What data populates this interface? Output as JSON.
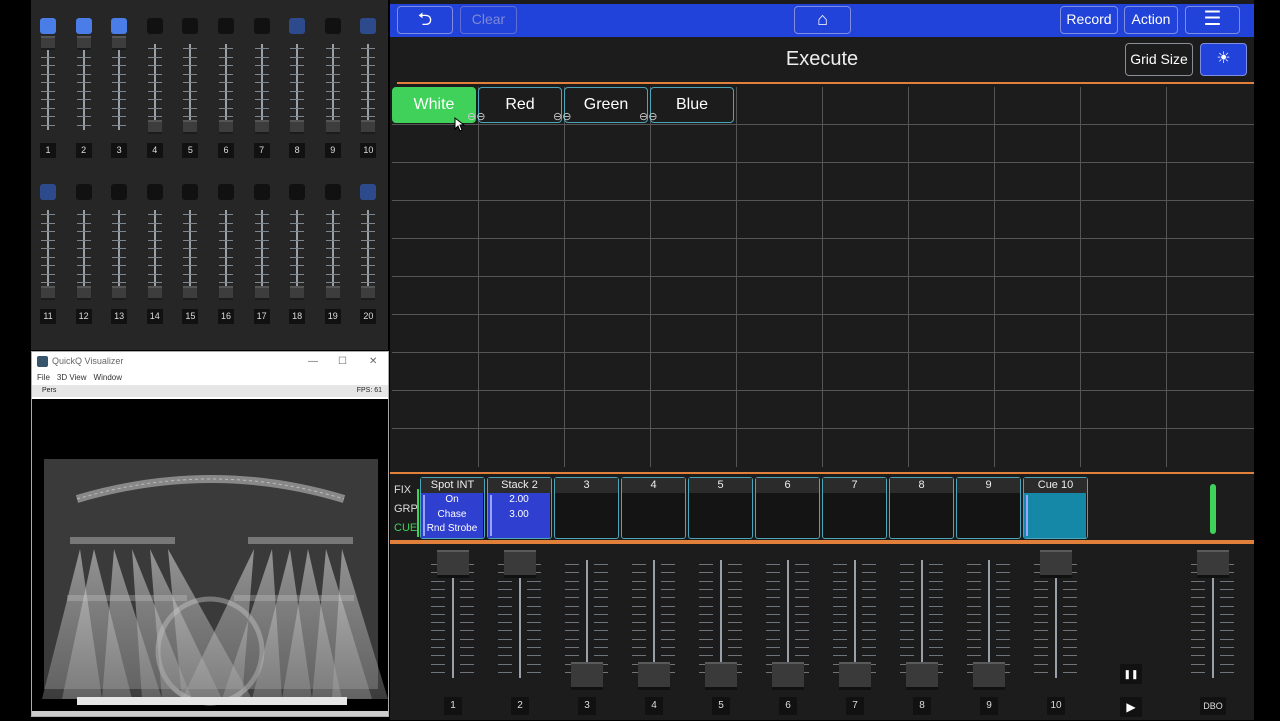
{
  "colors": {
    "accent_blue": "#2243d9",
    "active_green": "#3fd15a",
    "outline_teal": "#4aa6b8",
    "orange_rule": "#e0803b",
    "playback_blue": "#2f3fd0",
    "playback_teal": "#1588a8"
  },
  "mini_faders": {
    "row1": [
      {
        "num": "1",
        "button": "on"
      },
      {
        "num": "2",
        "button": "on"
      },
      {
        "num": "3",
        "button": "on"
      },
      {
        "num": "4",
        "button": "off"
      },
      {
        "num": "5",
        "button": "off"
      },
      {
        "num": "6",
        "button": "off"
      },
      {
        "num": "7",
        "button": "off"
      },
      {
        "num": "8",
        "button": "dim"
      },
      {
        "num": "9",
        "button": "off"
      },
      {
        "num": "10",
        "button": "dim"
      }
    ],
    "row2": [
      {
        "num": "11",
        "button": "dim"
      },
      {
        "num": "12",
        "button": "off"
      },
      {
        "num": "13",
        "button": "off"
      },
      {
        "num": "14",
        "button": "off"
      },
      {
        "num": "15",
        "button": "off"
      },
      {
        "num": "16",
        "button": "off"
      },
      {
        "num": "17",
        "button": "off"
      },
      {
        "num": "18",
        "button": "off"
      },
      {
        "num": "19",
        "button": "off"
      },
      {
        "num": "20",
        "button": "dim"
      }
    ]
  },
  "visualizer": {
    "title": "QuickQ Visualizer",
    "menu": [
      "File",
      "3D View",
      "Window"
    ],
    "view_mode": "Pers",
    "fps": "FPS: 61",
    "minimize": "—",
    "maximize": "☐",
    "close": "✕"
  },
  "topbar": {
    "back_icon": "undo-icon",
    "back_glyph": "⮌",
    "clear_label": "Clear",
    "home_icon": "home-icon",
    "home_glyph": "⌂",
    "record_label": "Record",
    "action_label": "Action",
    "menu_icon": "hamburger-icon",
    "menu_glyph": "☰"
  },
  "execute": {
    "title": "Execute",
    "grid_size_label": "Grid Size",
    "light_icon": "bulb-icon",
    "light_glyph": "☀",
    "cells": [
      {
        "label": "White",
        "active": true
      },
      {
        "label": "Red",
        "active": false
      },
      {
        "label": "Green",
        "active": false
      },
      {
        "label": "Blue",
        "active": false
      }
    ],
    "link_glyph": "⊖⊖"
  },
  "playbacks": {
    "modes": [
      "FIX",
      "GRP",
      "CUE"
    ],
    "items": [
      {
        "title": "Spot INT",
        "lines": [
          "On",
          "Chase",
          "Rnd Strobe"
        ],
        "style": "blue"
      },
      {
        "title": "Stack 2",
        "lines": [
          "2.00",
          "3.00"
        ],
        "style": "blue"
      },
      {
        "title": "3",
        "lines": [],
        "style": "empty"
      },
      {
        "title": "4",
        "lines": [],
        "style": "empty"
      },
      {
        "title": "5",
        "lines": [],
        "style": "empty"
      },
      {
        "title": "6",
        "lines": [],
        "style": "empty"
      },
      {
        "title": "7",
        "lines": [],
        "style": "empty"
      },
      {
        "title": "8",
        "lines": [],
        "style": "empty"
      },
      {
        "title": "9",
        "lines": [],
        "style": "empty"
      },
      {
        "title": "Cue 10",
        "lines": [],
        "style": "teal"
      }
    ]
  },
  "faders": {
    "channels": [
      {
        "num": "1",
        "level": 1.0
      },
      {
        "num": "2",
        "level": 1.0
      },
      {
        "num": "3",
        "level": 0.0
      },
      {
        "num": "4",
        "level": 0.0
      },
      {
        "num": "5",
        "level": 0.0
      },
      {
        "num": "6",
        "level": 0.0
      },
      {
        "num": "7",
        "level": 0.0
      },
      {
        "num": "8",
        "level": 0.0
      },
      {
        "num": "9",
        "level": 0.0
      },
      {
        "num": "10",
        "level": 1.0
      }
    ],
    "pause_glyph": "❚❚",
    "play_glyph": "▶",
    "dbo_label": "DBO",
    "dbo_level": 1.0
  }
}
